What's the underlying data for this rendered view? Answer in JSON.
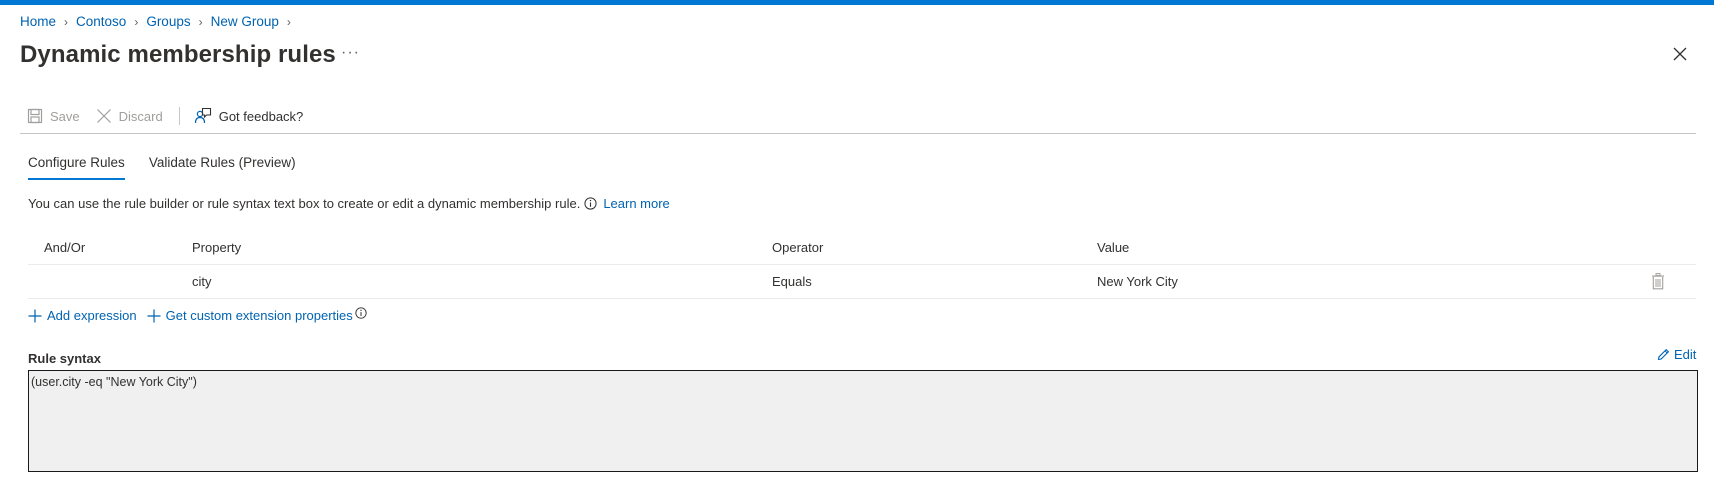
{
  "colors": {
    "accent": "#0078d4",
    "link": "#0063b1",
    "disabled": "#a19f9d"
  },
  "breadcrumb": [
    {
      "label": "Home"
    },
    {
      "label": "Contoso"
    },
    {
      "label": "Groups"
    },
    {
      "label": "New Group"
    }
  ],
  "page": {
    "title": "Dynamic membership rules",
    "more_label": "···"
  },
  "toolbar": {
    "save_label": "Save",
    "discard_label": "Discard",
    "feedback_label": "Got feedback?"
  },
  "tabs": [
    {
      "label": "Configure Rules",
      "active": true
    },
    {
      "label": "Validate Rules (Preview)",
      "active": false
    }
  ],
  "description": {
    "text": "You can use the rule builder or rule syntax text box to create or edit a dynamic membership rule.",
    "link": "Learn more"
  },
  "grid": {
    "columns": [
      "And/Or",
      "Property",
      "Operator",
      "Value"
    ],
    "rows": [
      {
        "andor": "",
        "property": "city",
        "operator": "Equals",
        "value": "New York City"
      }
    ]
  },
  "actions": {
    "add_expression": "Add expression",
    "custom_props": "Get custom extension properties"
  },
  "rule_syntax": {
    "label": "Rule syntax",
    "edit_label": "Edit",
    "value": "(user.city -eq \"New York City\")"
  },
  "icons": {
    "save": "save-icon",
    "discard": "close-icon",
    "feedback": "feedback-icon",
    "info": "info-icon",
    "delete": "trash-icon",
    "add": "plus-icon",
    "edit": "pencil-icon",
    "close": "close-icon"
  }
}
